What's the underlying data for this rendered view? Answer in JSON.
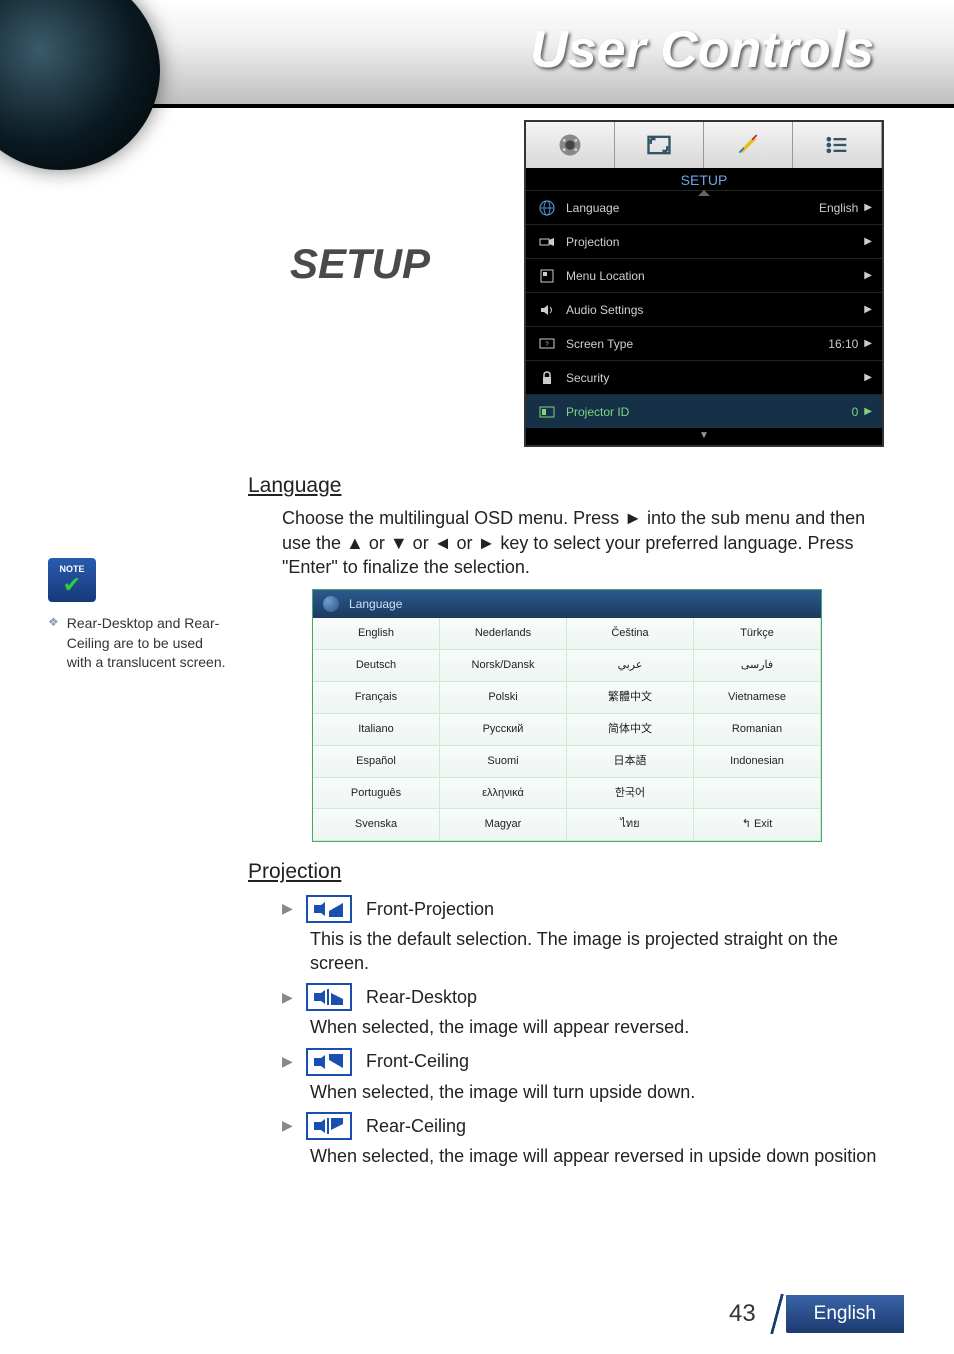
{
  "header": {
    "title": "User Controls"
  },
  "setup_heading": "SETUP",
  "setup_menu": {
    "title": "SETUP",
    "items": [
      {
        "label": "Language",
        "value": "English"
      },
      {
        "label": "Projection",
        "value": ""
      },
      {
        "label": "Menu Location",
        "value": ""
      },
      {
        "label": "Audio Settings",
        "value": ""
      },
      {
        "label": "Screen Type",
        "value": "16:10"
      },
      {
        "label": "Security",
        "value": ""
      },
      {
        "label": "Projector ID",
        "value": "0"
      }
    ]
  },
  "note": {
    "badge": "NOTE",
    "text": "Rear-Desktop and Rear-Ceiling are to be used with a translucent screen."
  },
  "sections": {
    "language": {
      "heading": "Language",
      "desc": "Choose the multilingual OSD menu. Press ► into the sub menu and then use the ▲ or ▼ or ◄ or ► key to select your preferred language. Press \"Enter\" to finalize the selection.",
      "panel_title": "Language",
      "grid": [
        [
          "English",
          "Nederlands",
          "Čeština",
          "Türkçe"
        ],
        [
          "Deutsch",
          "Norsk/Dansk",
          "عربي",
          "فارسی"
        ],
        [
          "Français",
          "Polski",
          "繁體中文",
          "Vietnamese"
        ],
        [
          "Italiano",
          "Русский",
          "简体中文",
          "Romanian"
        ],
        [
          "Español",
          "Suomi",
          "日本語",
          "Indonesian"
        ],
        [
          "Português",
          "ελληνικά",
          "한국어",
          ""
        ],
        [
          "Svenska",
          "Magyar",
          "ไทย",
          "↰ Exit"
        ]
      ]
    },
    "projection": {
      "heading": "Projection",
      "items": [
        {
          "title": "Front-Projection",
          "desc": "This is the default selection. The image is projected straight on the screen."
        },
        {
          "title": "Rear-Desktop",
          "desc": "When selected, the image will appear reversed."
        },
        {
          "title": "Front-Ceiling",
          "desc": "When selected, the image will turn upside down."
        },
        {
          "title": "Rear-Ceiling",
          "desc": "When selected, the image will appear reversed in upside down position"
        }
      ]
    }
  },
  "footer": {
    "page": "43",
    "lang": "English"
  }
}
